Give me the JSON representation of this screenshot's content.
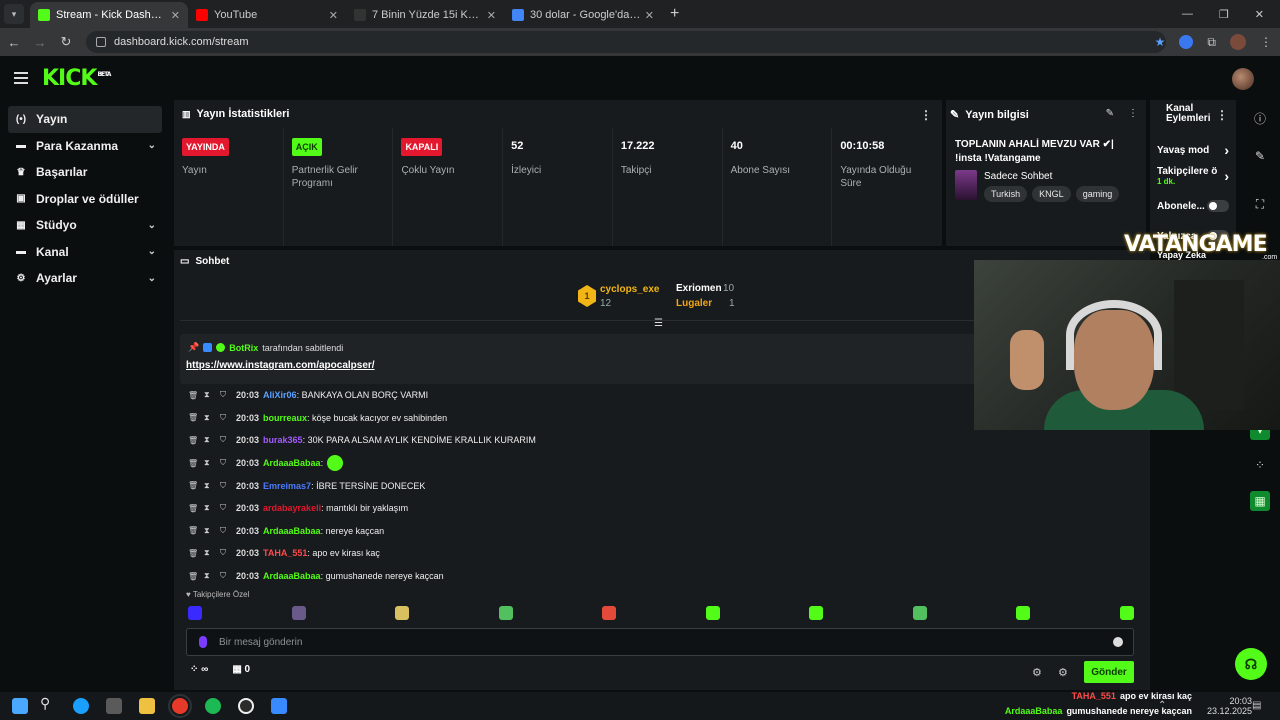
{
  "browser": {
    "tabs": [
      {
        "title": "Stream - Kick Dashboard",
        "active": true,
        "favicon_color": "#53fc18"
      },
      {
        "title": "YouTube",
        "active": false,
        "favicon_color": "#ff0000"
      },
      {
        "title": "7 Binin Yüzde 15i Kaçtır ? | YÜZD",
        "active": false,
        "favicon_color": "#333333"
      },
      {
        "title": "30 dolar - Google'da Ara",
        "active": false,
        "favicon_color": "#4285f4"
      }
    ],
    "url": "dashboard.kick.com/stream"
  },
  "sidebar": {
    "items": [
      {
        "label": "Yayın",
        "icon": "broadcast-icon",
        "glyph": "(•)",
        "expandable": false,
        "active": true
      },
      {
        "label": "Para Kazanma",
        "icon": "money-icon",
        "glyph": "▬",
        "expandable": true,
        "active": false
      },
      {
        "label": "Başarılar",
        "icon": "trophy-icon",
        "glyph": "♛",
        "expandable": false,
        "active": false
      },
      {
        "label": "Droplar ve ödüller",
        "icon": "gift-icon",
        "glyph": "▣",
        "expandable": false,
        "active": false
      },
      {
        "label": "Stüdyo",
        "icon": "studio-icon",
        "glyph": "▦",
        "expandable": true,
        "active": false
      },
      {
        "label": "Kanal",
        "icon": "channel-icon",
        "glyph": "▬",
        "expandable": true,
        "active": false
      },
      {
        "label": "Ayarlar",
        "icon": "gear-icon",
        "glyph": "⚙",
        "expandable": true,
        "active": false
      }
    ]
  },
  "stats": {
    "title": "Yayın İstatistikleri",
    "columns": [
      {
        "badge": "YAYINDA",
        "badge_color": "red",
        "label": "Yayın"
      },
      {
        "badge": "AÇIK",
        "badge_color": "green",
        "label": "Partnerlik Gelir Programı"
      },
      {
        "badge": "KAPALI",
        "badge_color": "red",
        "label": "Çoklu Yayın"
      },
      {
        "value": "52",
        "label": "İzleyici"
      },
      {
        "value": "17.222",
        "label": "Takipçi"
      },
      {
        "value": "40",
        "label": "Abone Sayısı"
      },
      {
        "value": "00:10:58",
        "label": "Yayında Olduğu Süre"
      }
    ]
  },
  "stream_info": {
    "title_label": "Yayın bilgisi",
    "stream_title": "TOPLANIN AHALİ MEVZU VAR ✔| !insta !Vatangame",
    "category": "Sadece Sohbet",
    "tags": [
      "Turkish",
      "KNGL",
      "gaming"
    ]
  },
  "channel_actions": {
    "title": "Kanal Eylemleri",
    "slow_mode": "Yavaş mod",
    "followers_only": "Takipçilere ö",
    "followers_sub": "1 dk.",
    "subscribers": "Abonele...",
    "only": "Yalnızca",
    "ai": "Yapay Zeka"
  },
  "chat": {
    "title": "Sohbet",
    "leaderboard": [
      {
        "rank": "1",
        "name": "cyclops_exe",
        "count": "12",
        "color": "#f2b516"
      },
      {
        "name": "Exriomen",
        "count": "10",
        "color": "#ffffff"
      },
      {
        "name": "Lugaler",
        "count": "1",
        "color": "#f2a516"
      }
    ],
    "pinned_by": "BotRix",
    "pinned_suffix": "tarafından sabitlendi",
    "pinned_link": "https://www.instagram.com/apocalpser/",
    "messages": [
      {
        "time": "20:03",
        "user": "AliXir06",
        "color": "#5aa0ff",
        "text": ": BANKAYA OLAN BORÇ VARMI"
      },
      {
        "time": "20:03",
        "user": "bourreaux",
        "color": "#53fc18",
        "text": ": köşe bucak kacıyor ev sahibinden"
      },
      {
        "time": "20:03",
        "user": "burak365",
        "color": "#a45aff",
        "text": ": 30K PARA ALSAM AYLIK KENDİME KRALLIK KURARIM"
      },
      {
        "time": "20:03",
        "user": "ArdaaaBabaa",
        "color": "#53fc18",
        "text": ":",
        "emote": true
      },
      {
        "time": "20:03",
        "user": "Emreimas7",
        "color": "#4a7bff",
        "text": ": İBRE TERSİNE DONECEK"
      },
      {
        "time": "20:03",
        "user": "ardabayrakeli",
        "color": "#e3172d",
        "text": ": mantıklı bir yaklaşım"
      },
      {
        "time": "20:03",
        "user": "ArdaaaBabaa",
        "color": "#53fc18",
        "text": ": nereye kaçcan"
      },
      {
        "time": "20:03",
        "user": "TAHA_551",
        "color": "#ff4a4a",
        "text": ": apo ev kirası kaç"
      },
      {
        "time": "20:03",
        "user": "ArdaaaBabaa",
        "color": "#53fc18",
        "text": ": gumushanede nereye kaçcan"
      }
    ],
    "emotes_header": "Takipçilere Özel",
    "emote_colors": [
      "#3a2aff",
      "#6a5a8a",
      "#d8c060",
      "#53c060",
      "#e34a3a",
      "#53fc18",
      "#53fc18",
      "#53c060",
      "#53fc18",
      "#53fc18"
    ],
    "input_placeholder": "Bir mesaj gönderin",
    "points": "∞",
    "gift_count": "0",
    "send_label": "Gönder"
  },
  "overlay": {
    "brand": "VATANGAME",
    "brand_sub": ".com",
    "chat": [
      {
        "user": "TAHA_551",
        "text": "apo ev kirası kaç",
        "color": "#ff4a4a"
      },
      {
        "user": "ArdaaaBabaa",
        "text": "gumushanede nereye kaçcan",
        "color": "#53fc18"
      }
    ]
  },
  "taskbar": {
    "time": "20:03",
    "date": "23.12.2025"
  }
}
